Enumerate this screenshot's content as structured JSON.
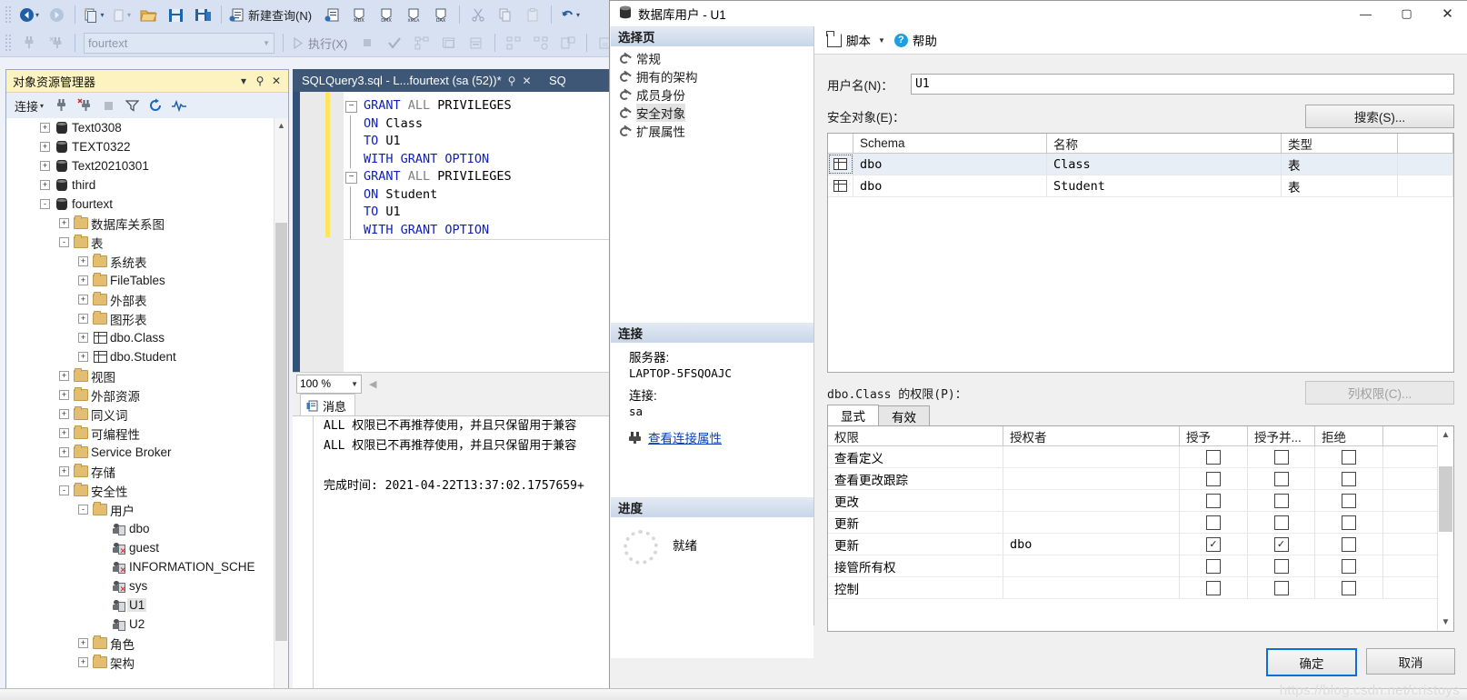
{
  "app": {
    "toolbar1": [
      {
        "name": "back",
        "label": "◀",
        "icon": "back-arrow-icon",
        "caret": true
      },
      {
        "name": "forward",
        "label": "▶",
        "icon": "forward-arrow-icon",
        "caret": false
      },
      {
        "name": "new-project",
        "label": "",
        "icon": "new-project-icon",
        "caret": true
      },
      {
        "name": "new-item",
        "label": "",
        "icon": "new-item-icon",
        "caret": true
      },
      {
        "name": "open-file",
        "label": "",
        "icon": "open-folder-icon",
        "caret": false
      },
      {
        "name": "save",
        "label": "",
        "icon": "save-icon",
        "caret": false
      },
      {
        "name": "save-all",
        "label": "",
        "icon": "save-all-icon",
        "caret": false
      },
      {
        "name": "new-query",
        "label": "新建查询(N)",
        "icon": "new-query-icon",
        "caret": false
      },
      {
        "name": "new-query-db",
        "label": "",
        "icon": "db-query-icon",
        "caret": false
      },
      {
        "name": "new-mdx-query",
        "label": "MDX",
        "icon": "mdx-query-icon",
        "caret": false
      },
      {
        "name": "new-dmx-query",
        "label": "DMX",
        "icon": "dmx-query-icon",
        "caret": false
      },
      {
        "name": "new-xmla-query",
        "label": "XMLA",
        "icon": "xmla-query-icon",
        "caret": false
      },
      {
        "name": "new-dax-query",
        "label": "DAX",
        "icon": "dax-query-icon",
        "caret": false
      },
      {
        "name": "cut",
        "label": "",
        "icon": "scissors-icon",
        "caret": false
      },
      {
        "name": "copy",
        "label": "",
        "icon": "copy-icon",
        "caret": false
      },
      {
        "name": "paste",
        "label": "",
        "icon": "paste-icon",
        "caret": false
      },
      {
        "name": "undo",
        "label": "",
        "icon": "undo-icon",
        "caret": true
      }
    ],
    "toolbar2": {
      "connect_icon": "connect-plug-icon",
      "disconnect_icon": "disconnect-plug-icon",
      "db_combo_value": "fourtext",
      "execute_label": "执行(X)",
      "buttons": [
        "stop-icon",
        "parse-check-icon",
        "display-estimated-plan-icon",
        "include-actual-plan-icon",
        "include-client-stats-icon",
        "query-options-icon",
        "results-to-text-icon",
        "results-to-grid-icon",
        "results-to-file-icon",
        "comment-icon",
        "uncomment-icon"
      ]
    }
  },
  "object_explorer": {
    "title": "对象资源管理器",
    "titlebar_icons": [
      "chevron-down-icon",
      "pin-icon",
      "close-icon"
    ],
    "connect_label": "连接",
    "toolbar_icons": [
      "connect-icon",
      "disconnect-icon",
      "stop-icon",
      "filter-icon",
      "refresh-icon",
      "activity-monitor-icon"
    ],
    "tree": [
      {
        "label": "Text0308",
        "indent": 1,
        "expander": "+",
        "icon": "database-icon"
      },
      {
        "label": "TEXT0322",
        "indent": 1,
        "expander": "+",
        "icon": "database-icon"
      },
      {
        "label": "Text20210301",
        "indent": 1,
        "expander": "+",
        "icon": "database-icon"
      },
      {
        "label": "third",
        "indent": 1,
        "expander": "+",
        "icon": "database-icon"
      },
      {
        "label": "fourtext",
        "indent": 1,
        "expander": "-",
        "icon": "database-icon"
      },
      {
        "label": "数据库关系图",
        "indent": 2,
        "expander": "+",
        "icon": "folder-icon"
      },
      {
        "label": "表",
        "indent": 2,
        "expander": "-",
        "icon": "folder-icon"
      },
      {
        "label": "系统表",
        "indent": 3,
        "expander": "+",
        "icon": "folder-icon"
      },
      {
        "label": "FileTables",
        "indent": 3,
        "expander": "+",
        "icon": "folder-icon"
      },
      {
        "label": "外部表",
        "indent": 3,
        "expander": "+",
        "icon": "folder-icon"
      },
      {
        "label": "图形表",
        "indent": 3,
        "expander": "+",
        "icon": "folder-icon"
      },
      {
        "label": "dbo.Class",
        "indent": 3,
        "expander": "+",
        "icon": "table-icon"
      },
      {
        "label": "dbo.Student",
        "indent": 3,
        "expander": "+",
        "icon": "table-icon"
      },
      {
        "label": "视图",
        "indent": 2,
        "expander": "+",
        "icon": "folder-icon"
      },
      {
        "label": "外部资源",
        "indent": 2,
        "expander": "+",
        "icon": "folder-icon"
      },
      {
        "label": "同义词",
        "indent": 2,
        "expander": "+",
        "icon": "folder-icon"
      },
      {
        "label": "可编程性",
        "indent": 2,
        "expander": "+",
        "icon": "folder-icon"
      },
      {
        "label": "Service Broker",
        "indent": 2,
        "expander": "+",
        "icon": "folder-icon"
      },
      {
        "label": "存储",
        "indent": 2,
        "expander": "+",
        "icon": "folder-icon"
      },
      {
        "label": "安全性",
        "indent": 2,
        "expander": "-",
        "icon": "folder-icon"
      },
      {
        "label": "用户",
        "indent": 3,
        "expander": "-",
        "icon": "folder-icon"
      },
      {
        "label": "dbo",
        "indent": 4,
        "expander": "",
        "icon": "user-icon"
      },
      {
        "label": "guest",
        "indent": 4,
        "expander": "",
        "icon": "user-disabled-icon"
      },
      {
        "label": "INFORMATION_SCHE",
        "indent": 4,
        "expander": "",
        "icon": "user-disabled-icon"
      },
      {
        "label": "sys",
        "indent": 4,
        "expander": "",
        "icon": "user-disabled-icon"
      },
      {
        "label": "U1",
        "indent": 4,
        "expander": "",
        "icon": "user-icon",
        "selected": true
      },
      {
        "label": "U2",
        "indent": 4,
        "expander": "",
        "icon": "user-icon"
      },
      {
        "label": "角色",
        "indent": 3,
        "expander": "+",
        "icon": "folder-icon"
      },
      {
        "label": "架构",
        "indent": 3,
        "expander": "+",
        "icon": "folder-icon"
      }
    ]
  },
  "editor": {
    "tabs": [
      {
        "label": "SQLQuery3.sql - L...fourtext (sa (52))*",
        "active": true
      },
      {
        "label": "SQ",
        "active": false
      }
    ],
    "tab_icons": [
      "pin-icon",
      "close-icon"
    ],
    "code_lines": [
      [
        {
          "t": "GRANT",
          "c": "kw"
        },
        {
          "t": " ",
          "c": "blk"
        },
        {
          "t": "ALL",
          "c": "gray"
        },
        {
          "t": " PRIVILEGES",
          "c": "blk"
        }
      ],
      [
        {
          "t": "ON",
          "c": "kw"
        },
        {
          "t": " Class",
          "c": "blk"
        }
      ],
      [
        {
          "t": "TO",
          "c": "kw"
        },
        {
          "t": " U1",
          "c": "blk"
        }
      ],
      [
        {
          "t": "WITH GRANT OPTION",
          "c": "kw"
        }
      ],
      [
        {
          "t": "GRANT",
          "c": "kw"
        },
        {
          "t": " ",
          "c": "blk"
        },
        {
          "t": "ALL",
          "c": "gray"
        },
        {
          "t": " PRIVILEGES",
          "c": "blk"
        }
      ],
      [
        {
          "t": "ON",
          "c": "kw"
        },
        {
          "t": " Student",
          "c": "blk"
        }
      ],
      [
        {
          "t": "TO",
          "c": "kw"
        },
        {
          "t": " U1",
          "c": "blk"
        }
      ],
      [
        {
          "t": "WITH GRANT OPTION",
          "c": "kw"
        }
      ]
    ],
    "zoom_level": "100 %"
  },
  "results": {
    "tab_label": "消息",
    "tab_icon": "messages-icon",
    "messages": [
      "ALL 权限已不再推荐使用，并且只保留用于兼容",
      "ALL 权限已不再推荐使用，并且只保留用于兼容",
      "",
      "完成时间: 2021-04-22T13:37:02.1757659+"
    ]
  },
  "dialog": {
    "title": "数据库用户 - U1",
    "title_icon": "database-icon",
    "window_buttons": [
      {
        "name": "minimize-button",
        "glyph": "—"
      },
      {
        "name": "maximize-button",
        "glyph": "▢"
      },
      {
        "name": "close-button",
        "glyph": "✕"
      }
    ],
    "select_page": {
      "header": "选择页",
      "items": [
        {
          "label": "常规",
          "selected": false
        },
        {
          "label": "拥有的架构",
          "selected": false
        },
        {
          "label": "成员身份",
          "selected": false
        },
        {
          "label": "安全对象",
          "selected": true
        },
        {
          "label": "扩展属性",
          "selected": false
        }
      ]
    },
    "connection": {
      "header": "连接",
      "server_label": "服务器:",
      "server_value": "LAPTOP-5FSQOAJC",
      "conn_label": "连接:",
      "conn_value": "sa",
      "view_props_link": "查看连接属性",
      "link_icon": "connect-plug-icon"
    },
    "progress": {
      "header": "进度",
      "status": "就绪",
      "spinner_icon": "spinner-icon"
    },
    "toolbar": {
      "script_label": "脚本",
      "script_icon": "script-icon",
      "help_label": "帮助",
      "help_icon": "question-mark-icon"
    },
    "username": {
      "label": "用户名(N)：",
      "value": "U1"
    },
    "securables": {
      "label": "安全对象(E)：",
      "search_button": "搜索(S)...",
      "columns": [
        "Schema",
        "名称",
        "类型"
      ],
      "rows": [
        {
          "icon": "table-icon",
          "schema": "dbo",
          "name": "Class",
          "type": "表",
          "selected": true
        },
        {
          "icon": "table-icon",
          "schema": "dbo",
          "name": "Student",
          "type": "表",
          "selected": false
        }
      ]
    },
    "permissions": {
      "label": "dbo.Class 的权限(P)：",
      "column_perms_button": "列权限(C)...",
      "tabs": [
        {
          "label": "显式",
          "active": true
        },
        {
          "label": "有效",
          "active": false
        }
      ],
      "columns": [
        "权限",
        "授权者",
        "授予",
        "授予并...",
        "拒绝"
      ],
      "rows": [
        {
          "perm": "查看定义",
          "grantor": "",
          "grant": false,
          "grant_with": false,
          "deny": false
        },
        {
          "perm": "查看更改跟踪",
          "grantor": "",
          "grant": false,
          "grant_with": false,
          "deny": false
        },
        {
          "perm": "更改",
          "grantor": "",
          "grant": false,
          "grant_with": false,
          "deny": false
        },
        {
          "perm": "更新",
          "grantor": "",
          "grant": false,
          "grant_with": false,
          "deny": false
        },
        {
          "perm": "更新",
          "grantor": "dbo",
          "grant": true,
          "grant_with": true,
          "deny": false
        },
        {
          "perm": "接管所有权",
          "grantor": "",
          "grant": false,
          "grant_with": false,
          "deny": false
        },
        {
          "perm": "控制",
          "grantor": "",
          "grant": false,
          "grant_with": false,
          "deny": false
        }
      ]
    },
    "footer": {
      "ok": "确定",
      "cancel": "取消"
    }
  },
  "watermark": "https://blog.csdn.net/cristoys",
  "colors": {
    "accent_blue": "#0a6fd8",
    "titlebar_yellow": "#fdf3c1",
    "toolbar_blue": "#d7e1f2",
    "editor_stripe": "#31507a",
    "keyword_blue": "#1020c0"
  }
}
